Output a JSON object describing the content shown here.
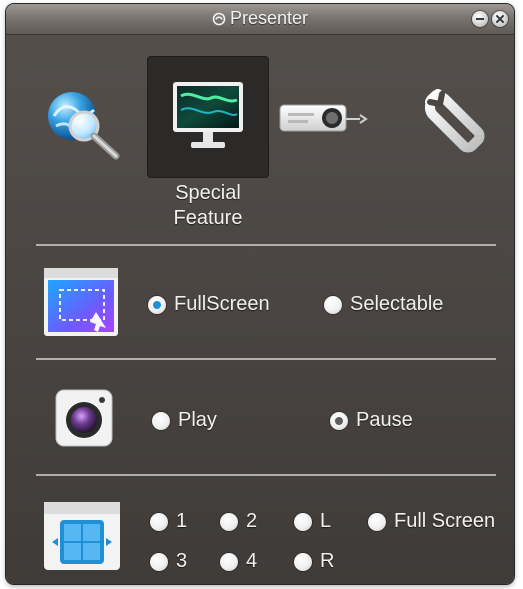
{
  "window": {
    "title": "Presenter",
    "minimize_label": "minimize",
    "close_label": "close"
  },
  "tabs": [
    {
      "id": "network",
      "icon": "globe-search-icon",
      "label": ""
    },
    {
      "id": "special_feature",
      "icon": "monitor-icon",
      "label": "Special\nFeature",
      "selected": true
    },
    {
      "id": "projector",
      "icon": "projector-icon",
      "label": ""
    },
    {
      "id": "settings",
      "icon": "wrench-icon",
      "label": ""
    }
  ],
  "sections": {
    "display_mode": {
      "icon": "screen-selection-icon",
      "options": [
        {
          "label": "FullScreen",
          "selected": true
        },
        {
          "label": "Selectable",
          "selected": false
        }
      ]
    },
    "playback": {
      "icon": "camera-icon",
      "options": [
        {
          "label": "Play",
          "selected": false
        },
        {
          "label": "Pause",
          "selected": true
        }
      ]
    },
    "split_screen": {
      "icon": "split-screen-icon",
      "options": [
        {
          "label": "1",
          "selected": false
        },
        {
          "label": "2",
          "selected": false
        },
        {
          "label": "L",
          "selected": false
        },
        {
          "label": "Full Screen",
          "selected": false
        },
        {
          "label": "3",
          "selected": false
        },
        {
          "label": "4",
          "selected": false
        },
        {
          "label": "R",
          "selected": false
        }
      ]
    }
  },
  "colors": {
    "accent_blue": "#1f8fd6",
    "panel_bg": "#4b4643",
    "selected_tab_bg": "#2c2a29"
  }
}
